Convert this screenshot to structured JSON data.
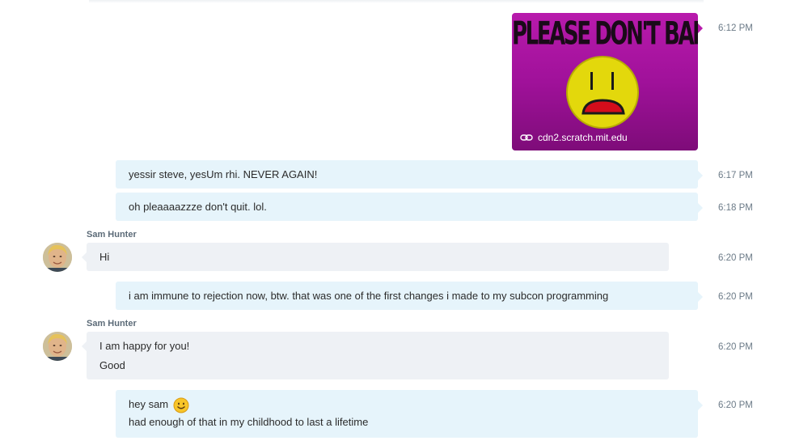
{
  "messages": [
    {
      "time": "6:12 PM",
      "image": {
        "caption": "PLEASE DON'T BAN ME!!!!",
        "link": "cdn2.scratch.mit.edu",
        "link_icon": "link-icon",
        "content_icon": "sad-face-icon"
      }
    },
    {
      "time": "6:17 PM",
      "lines": [
        "yessir steve, yesUm rhi.  NEVER AGAIN!"
      ]
    },
    {
      "time": "6:18 PM",
      "lines": [
        "oh pleaaaazzze don't quit.  lol."
      ]
    },
    {
      "sender": "Sam Hunter",
      "time": "6:20 PM",
      "lines": [
        "Hi"
      ]
    },
    {
      "time": "6:20 PM",
      "lines": [
        "i am immune to rejection now, btw.  that was one of the first changes i made to my subcon programming"
      ]
    },
    {
      "sender": "Sam Hunter",
      "time": "6:20 PM",
      "lines": [
        "I am happy for you!",
        "Good"
      ]
    },
    {
      "time": "6:20 PM",
      "lines": [
        "hey sam",
        "had enough of that in my childhood to last a lifetime"
      ],
      "emoji": "smile-emoji-icon"
    }
  ],
  "colors": {
    "outgoing_bubble": "#e6f4fb",
    "incoming_bubble": "#eef1f5",
    "image_bg": "#a0119a",
    "timestamp": "#6b7a87"
  }
}
